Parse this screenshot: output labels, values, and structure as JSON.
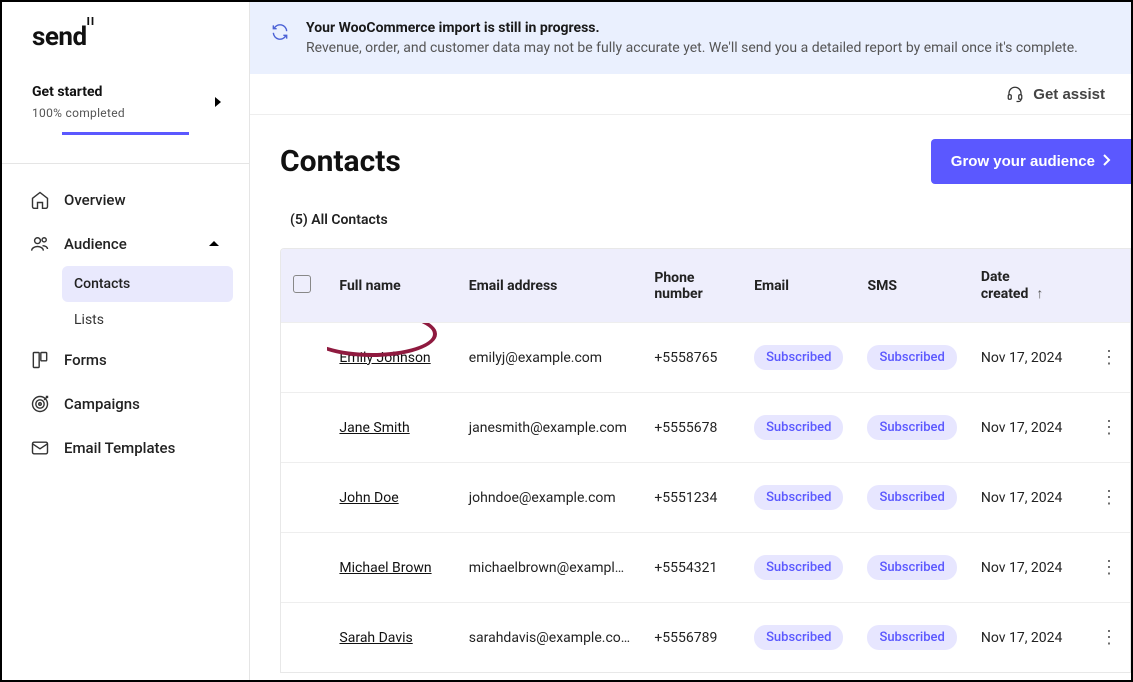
{
  "brand": {
    "name": "send",
    "accent": "II"
  },
  "getStarted": {
    "title": "Get started",
    "subtitle": "100% completed"
  },
  "sidebar": {
    "items": [
      {
        "label": "Overview",
        "name": "overview"
      },
      {
        "label": "Audience",
        "name": "audience",
        "expanded": true,
        "children": [
          {
            "label": "Contacts",
            "active": true
          },
          {
            "label": "Lists",
            "active": false
          }
        ]
      },
      {
        "label": "Forms",
        "name": "forms"
      },
      {
        "label": "Campaigns",
        "name": "campaigns"
      },
      {
        "label": "Email Templates",
        "name": "email-templates"
      }
    ]
  },
  "banner": {
    "title": "Your WooCommerce import is still in progress.",
    "subtitle": "Revenue, order, and customer data may not be fully accurate yet. We'll send you a detailed report by email once it's complete."
  },
  "assist": {
    "label": "Get assist"
  },
  "page": {
    "title": "Contacts",
    "ctaLabel": "Grow your audience",
    "tabLabel": "(5) All Contacts"
  },
  "table": {
    "columns": {
      "fullName": "Full name",
      "email": "Email address",
      "phone": "Phone number",
      "emailStatus": "Email",
      "smsStatus": "SMS",
      "dateCreated": "Date created"
    },
    "rows": [
      {
        "name": "Emily Johnson",
        "email": "emilyj@example.com",
        "phone": "+5558765",
        "emailStatus": "Subscribed",
        "smsStatus": "Subscribed",
        "date": "Nov 17, 2024",
        "highlighted": true
      },
      {
        "name": "Jane Smith",
        "email": "janesmith@example.com",
        "phone": "+5555678",
        "emailStatus": "Subscribed",
        "smsStatus": "Subscribed",
        "date": "Nov 17, 2024"
      },
      {
        "name": "John Doe",
        "email": "johndoe@example.com",
        "phone": "+5551234",
        "emailStatus": "Subscribed",
        "smsStatus": "Subscribed",
        "date": "Nov 17, 2024"
      },
      {
        "name": "Michael Brown",
        "email": "michaelbrown@example…",
        "phone": "+5554321",
        "emailStatus": "Subscribed",
        "smsStatus": "Subscribed",
        "date": "Nov 17, 2024"
      },
      {
        "name": "Sarah Davis",
        "email": "sarahdavis@example.com",
        "phone": "+5556789",
        "emailStatus": "Subscribed",
        "smsStatus": "Subscribed",
        "date": "Nov 17, 2024"
      }
    ]
  }
}
